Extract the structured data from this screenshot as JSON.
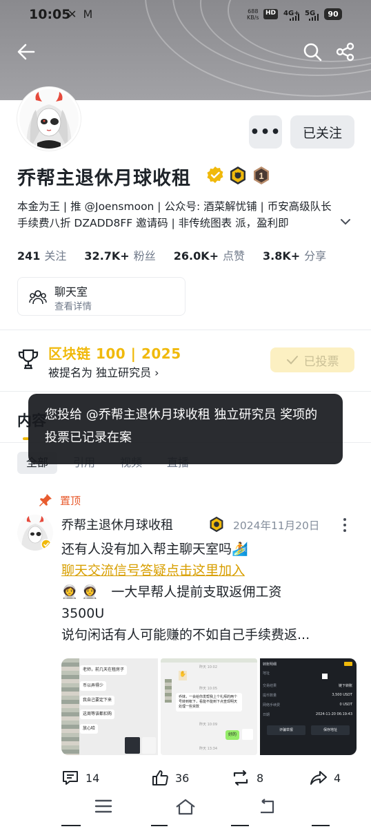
{
  "status_bar": {
    "time": "10:05",
    "notifications": "✕ M",
    "net_speed_value": "688",
    "net_speed_unit": "KB/s",
    "hd_label": "HD",
    "signal1": "4G+",
    "signal2": "5G",
    "battery": "90"
  },
  "header": {
    "back_icon": "arrow-left-icon",
    "search_icon": "search-icon",
    "share_icon": "share-icon"
  },
  "profile": {
    "more_label": "•••",
    "follow_label": "已关注",
    "name": "乔帮主退休月球收租",
    "rank_badge": "1",
    "bio": "本金为王 | 推 @Joensmoon | 公众号: 酒菜解忧铺 | 币安高级队长 手续费八折 DZADD8FF 邀请码 | 非传统图表 派，盈利即",
    "stats": [
      {
        "value": "241",
        "label": "关注"
      },
      {
        "value": "32.7K+",
        "label": "粉丝"
      },
      {
        "value": "26.0K+",
        "label": "点赞"
      },
      {
        "value": "3.8K+",
        "label": "分享"
      }
    ],
    "chatroom": {
      "title": "聊天室",
      "subtitle": "查看详情"
    }
  },
  "award": {
    "title": "区块链 100 | 2025",
    "subtitle": "被提名为 独立研究员 ›",
    "voted_label": "已投票"
  },
  "tabs": {
    "content_label": "内容",
    "filters": [
      "全部",
      "引用",
      "视频",
      "直播"
    ]
  },
  "toast": {
    "message": "您投给 @乔帮主退休月球收租 独立研究员 奖项的投票已记录在案"
  },
  "post": {
    "pinned_label": "置顶",
    "author": "乔帮主退休月球收租",
    "date": "2024年11月20日",
    "line1": "还有人没有加入帮主聊天室吗🏄",
    "link": "聊天交流信号答疑点击这里加入",
    "line3": "👩‍🚀 👩‍🚀　一大早帮人提前支取返佣工资",
    "line4": "3500U",
    "line5": "说句闲话有人可能赚的不如自己手续费返...",
    "thumb1_bubbles": [
      "老师，前几天在租房子",
      "币以弄得少",
      "我自己要定下来",
      "这周等该都扣购",
      "放心哈"
    ],
    "thumb2_top": "昨天 10:02",
    "thumb2_mid": "昨天 10:05",
    "thumb2_bubble": "乔妹，一会给你发帮我上个礼拜的两个号转到帐下，看能不能到下点查现明天处理一些资款",
    "thumb2_time": "昨天 10:09",
    "thumb2_reply": "好的",
    "thumb2_bottom": "昨天 13:34",
    "thumb3_title": "转账明细",
    "thumb3_rows": [
      {
        "k": "地址",
        "v": ""
      },
      {
        "k": "交易结果",
        "v": "链下转账"
      },
      {
        "k": "提币数量",
        "v": "3,500 USDT"
      },
      {
        "k": "网络手续费",
        "v": "0 USDT"
      },
      {
        "k": "日期",
        "v": "2024-11-20 06:19:43"
      }
    ],
    "thumb3_btn1": "诈骗举报",
    "thumb3_btn2": "保存地址",
    "comments": "14",
    "likes": "36",
    "reposts": "8",
    "shares": "4"
  },
  "navbar": {
    "menu_icon": "menu-icon",
    "home_icon": "home-icon",
    "back_icon": "back-icon"
  },
  "colors": {
    "accent": "#F0B90B",
    "pinned": "#E85B2E",
    "link": "#D89F00"
  }
}
